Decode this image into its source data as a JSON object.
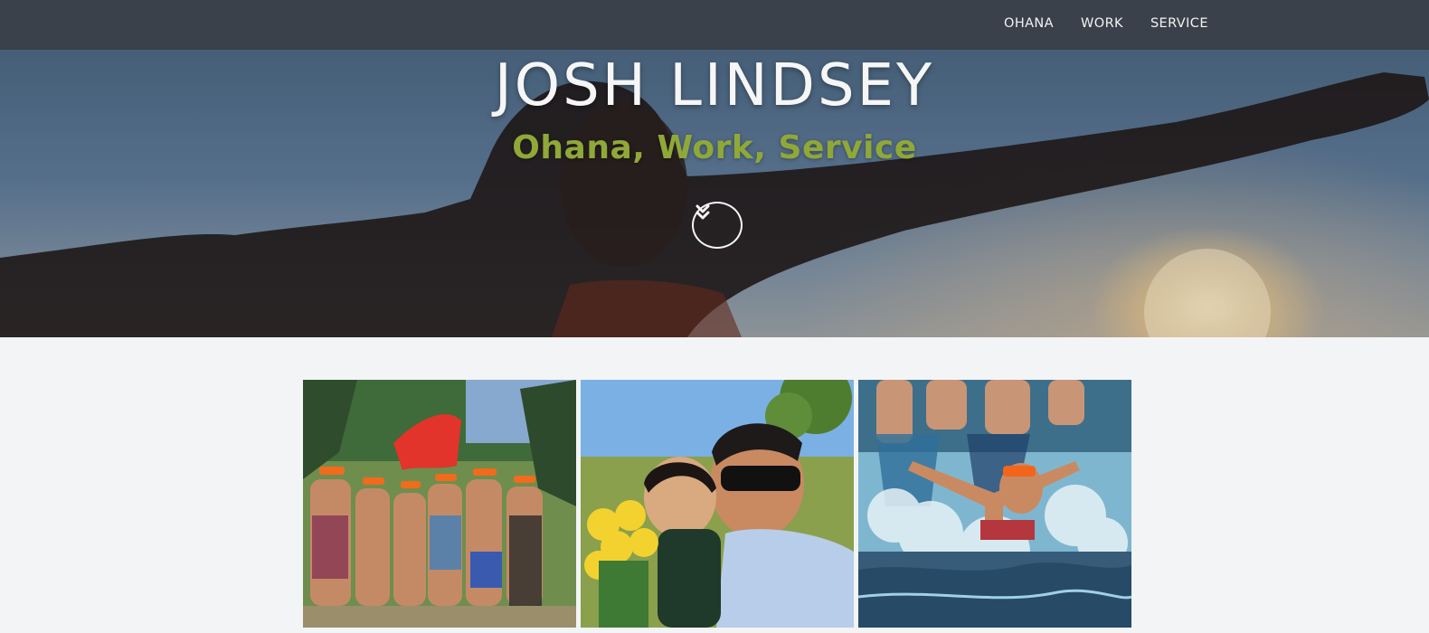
{
  "nav": {
    "items": [
      {
        "label": "OHANA"
      },
      {
        "label": "WORK"
      },
      {
        "label": "SERVICE"
      }
    ]
  },
  "hero": {
    "title": "JOSH LINDSEY",
    "subtitle": "Ohana, Work, Service",
    "scroll_icon": "chevrons-down-icon"
  },
  "gallery": {
    "photos": [
      {
        "name": "group-photo"
      },
      {
        "name": "family-photo"
      },
      {
        "name": "waterfall-photo"
      }
    ]
  },
  "colors": {
    "navbar": "#3a414b",
    "subtitle": "#8fa838",
    "page_background": "#f3f4f6"
  }
}
